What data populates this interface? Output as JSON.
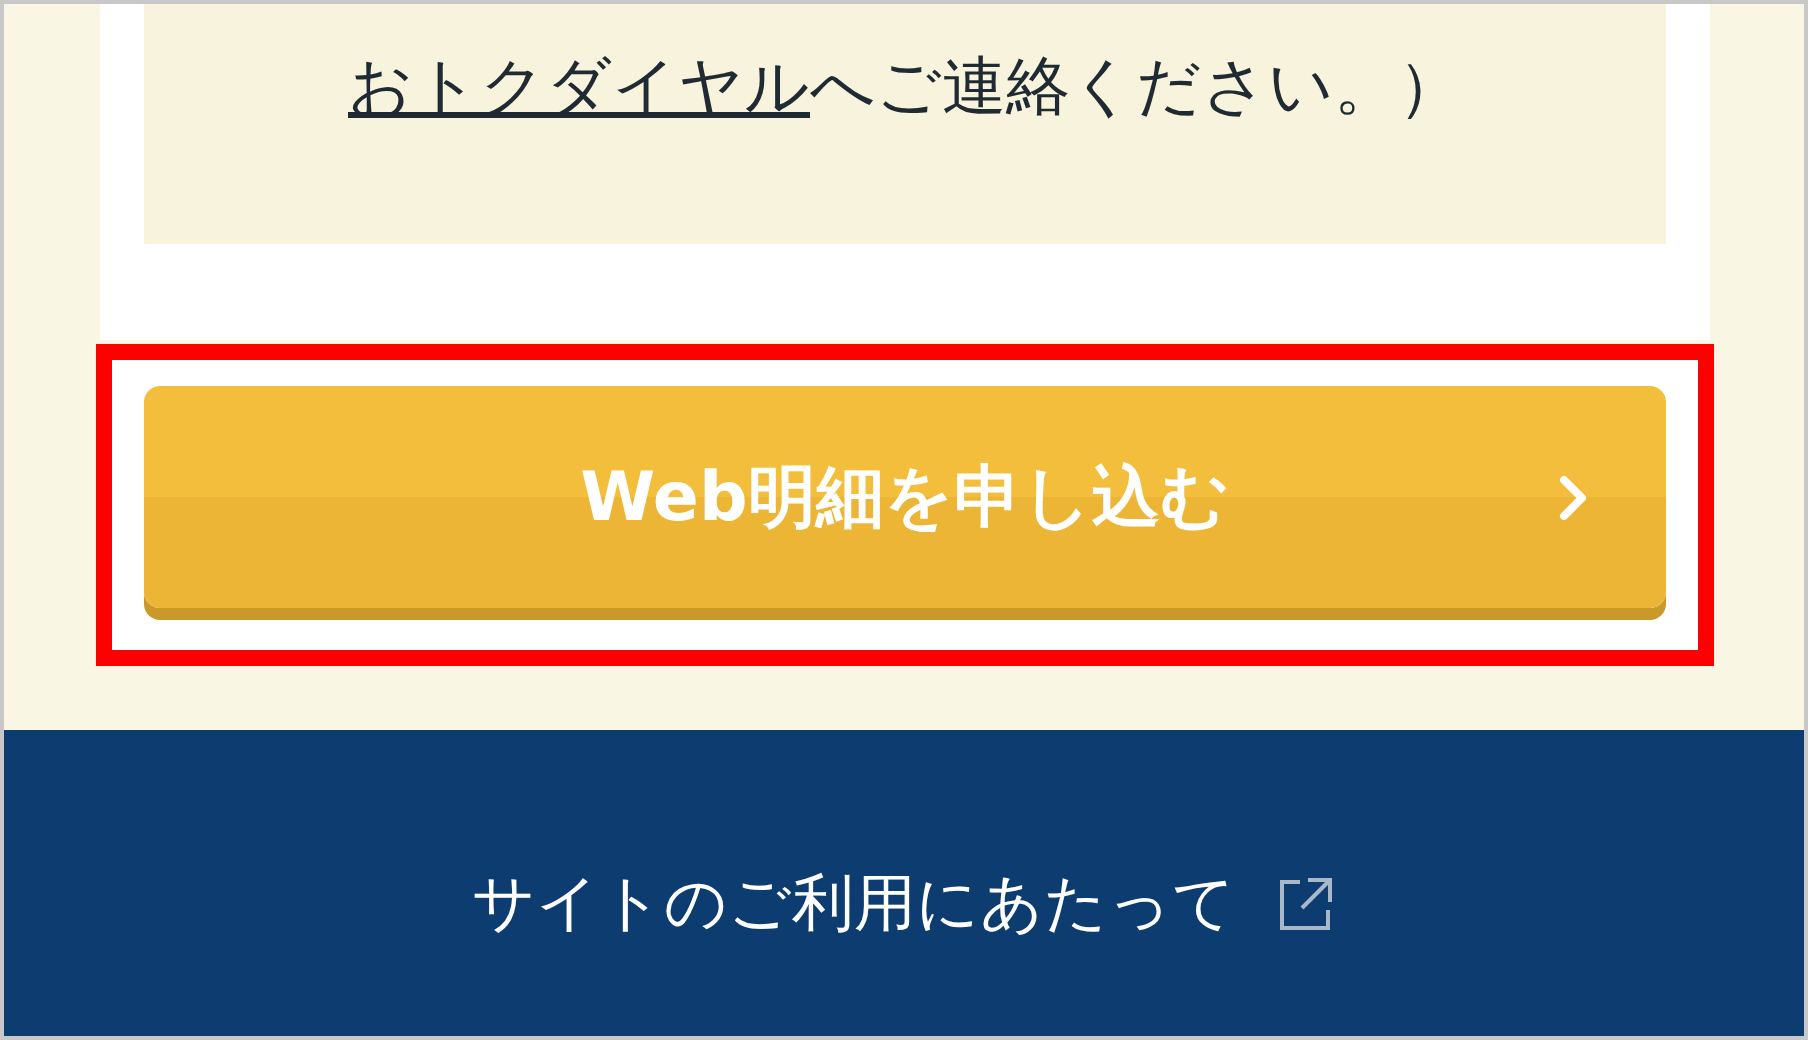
{
  "notice": {
    "link": "おトクダイヤル",
    "text": "へご連絡ください。）"
  },
  "apply_button": {
    "label": "Web明細を申し込む"
  },
  "footer": {
    "link": "サイトのご利用にあたって"
  }
}
